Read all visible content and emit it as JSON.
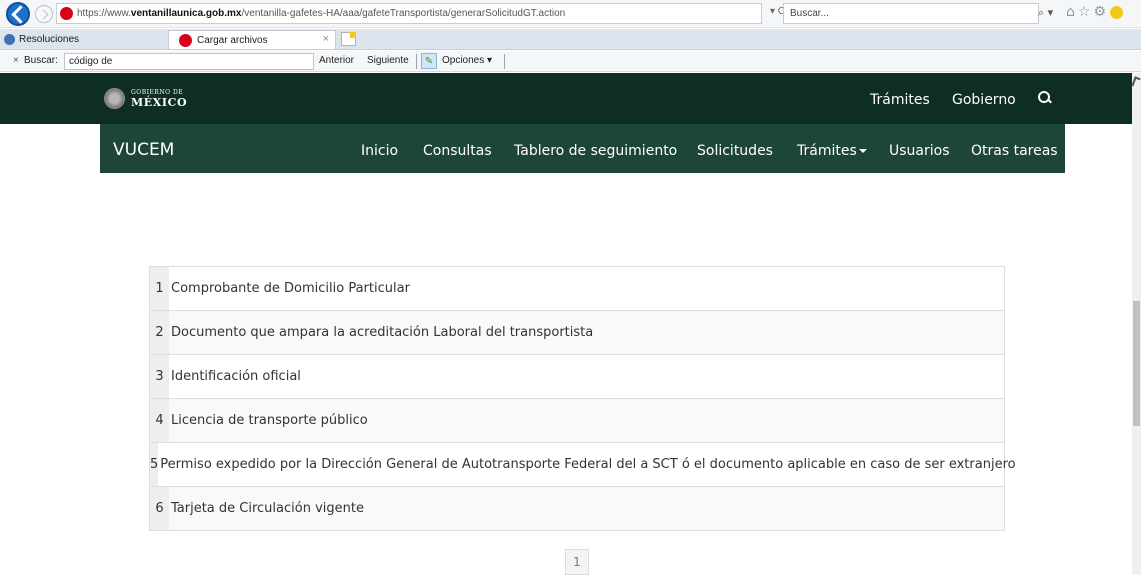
{
  "browser": {
    "url_prefix": "https://www.",
    "url_domain": "ventanillaunica.gob.mx",
    "url_path": "/ventanilla-gafetes-HA/aaa/gafeteTransportista/generarSolicitudGT.action",
    "url_tools": "▾ C",
    "search_placeholder": "Buscar...",
    "search_icon": "⌕ ▾",
    "toolbar_icons": "⌂☆⚙",
    "tabs": [
      {
        "label": "Resoluciones"
      },
      {
        "label": "Cargar archivos",
        "close": "×"
      }
    ],
    "find": {
      "close": "×",
      "label": "Buscar:",
      "value": "código de",
      "prev_label": "Anterior",
      "next_label": "Siguiente",
      "pencil": "✎",
      "options_label": "Opciones ▾"
    }
  },
  "gob_header": {
    "logo_small": "GOBIERNO DE",
    "logo_big": "MÉXICO",
    "links": [
      "Trámites",
      "Gobierno"
    ]
  },
  "vucem_nav": {
    "brand": "VUCEM",
    "items": [
      "Inicio",
      "Consultas",
      "Tablero de seguimiento",
      "Solicitudes",
      "Trámites",
      "Usuarios",
      "Otras tareas"
    ]
  },
  "documents": [
    {
      "num": "1",
      "label": "Comprobante de Domicilio Particular"
    },
    {
      "num": "2",
      "label": "Documento que ampara la acreditación Laboral del transportista"
    },
    {
      "num": "3",
      "label": "Identificación oficial"
    },
    {
      "num": "4",
      "label": "Licencia de transporte público"
    },
    {
      "num": "5",
      "label": "Permiso expedido por la Dirección General de Autotransporte Federal del a SCT ó el documento aplicable en caso de ser extranjero"
    },
    {
      "num": "6",
      "label": "Tarjeta de Circulación vigente"
    }
  ],
  "pagination": {
    "current": "1"
  },
  "colors": {
    "gob_bar": "#0e2e23",
    "vucem_bar": "#1e4636",
    "favicon_red": "#d9001b"
  }
}
